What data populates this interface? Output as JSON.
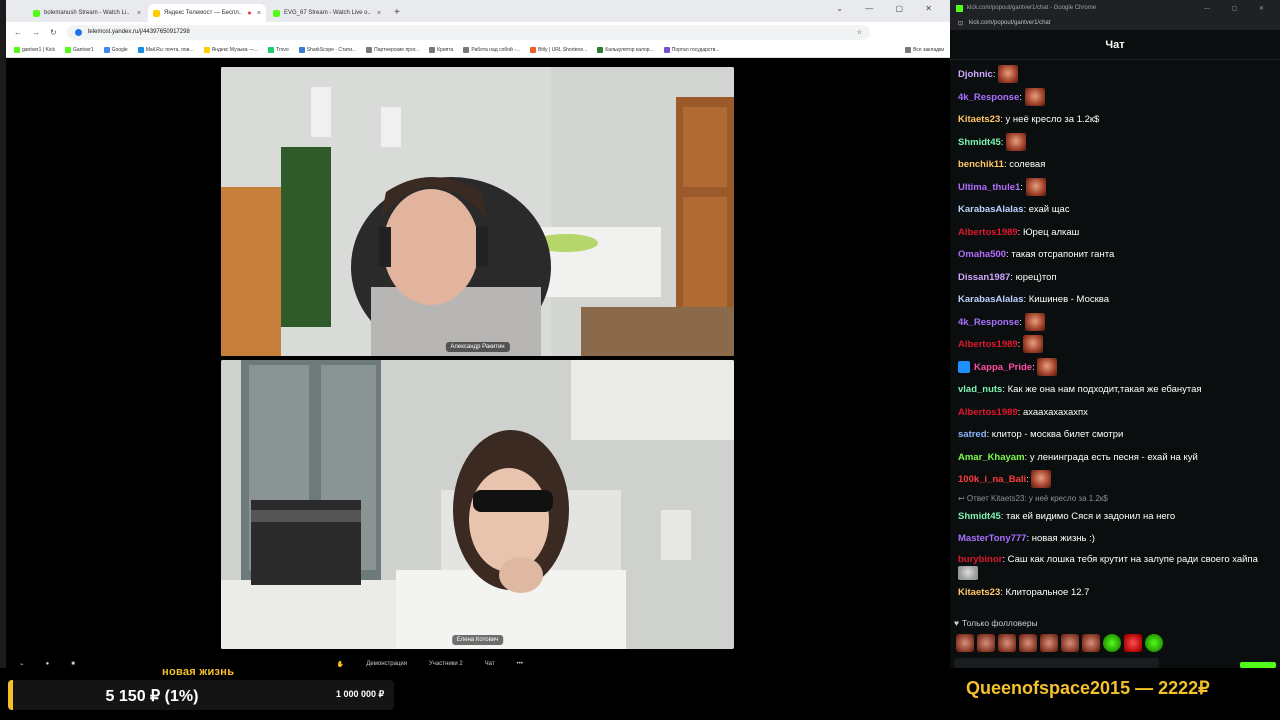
{
  "browser_left": {
    "tabs": [
      {
        "label": "bolemanush Stream - Watch Li..",
        "color": "#53fc18"
      },
      {
        "label": "Яндекс Телемост — Беспл..",
        "color": "#ffcc00"
      },
      {
        "label": "EVG_67 Stream - Watch Live o..",
        "color": "#53fc18"
      }
    ],
    "url": "telemost.yandex.ru/j/44397650917298",
    "bookmarks": [
      "gantver1 | Kick",
      "Gantver1",
      "Google",
      "Mail.Ru: почта, пои...",
      "Яндекс Музыка —...",
      "Trovo",
      "SharkScope - Стати...",
      "Партнерские прог...",
      "Крипта",
      "Работа над собой -...",
      "Bitly | URL Shortene...",
      "Калькулятор калор...",
      "Портал государств...",
      "Все закладки"
    ]
  },
  "call": {
    "participants": [
      {
        "name": "Александр Ракитин"
      },
      {
        "name": "Елена Котович"
      }
    ],
    "controls": [
      "Демонстрация",
      "Участники 2",
      "Чат"
    ]
  },
  "chat_window": {
    "title": "kick.com/popout/gantver1/chat - Google Chrome",
    "url": "kick.com/popout/gantver1/chat",
    "header": "Чат",
    "messages": [
      {
        "user": "Djohnic",
        "color": "#d0a8ff",
        "text": "",
        "emote": true
      },
      {
        "user": "4k_Response",
        "color": "#a970ff",
        "text": "",
        "emote": true
      },
      {
        "user": "Kitaets23",
        "color": "#ffc766",
        "text": "у неё кресло за 1.2к$"
      },
      {
        "user": "Shmidt45",
        "color": "#7cf5b0",
        "text": "",
        "emote": true
      },
      {
        "user": "benchik11",
        "color": "#ffc766",
        "text": "солевая"
      },
      {
        "user": "Ultima_thule1",
        "color": "#b36bff",
        "text": "",
        "emote": true
      },
      {
        "user": "KarabasAlalas",
        "color": "#b9d2ff",
        "text": "ехай щас"
      },
      {
        "user": "Albertos1989",
        "color": "#e0162b",
        "text": "Юрец алкаш"
      },
      {
        "user": "Omaha500",
        "color": "#b36bff",
        "text": "такая отсрапонит ганта"
      },
      {
        "user": "Dissan1987",
        "color": "#d0a8ff",
        "text": "юрец)топ"
      },
      {
        "user": "KarabasAlalas",
        "color": "#b9d2ff",
        "text": "Кишинев - Москва"
      },
      {
        "user": "4k_Response",
        "color": "#a970ff",
        "text": "",
        "emote": true
      },
      {
        "user": "Albertos1989",
        "color": "#e0162b",
        "text": "",
        "emote": true
      },
      {
        "user": "Kappa_Pride",
        "color": "#ff4da6",
        "text": "",
        "emote": true,
        "badge": true
      },
      {
        "user": "vlad_nuts",
        "color": "#7cf5b0",
        "text": "Как же она нам подходит,такая же ебанутая"
      },
      {
        "user": "Albertos1989",
        "color": "#e0162b",
        "text": "ахаахахахахпх"
      },
      {
        "user": "satred",
        "color": "#8cb8ff",
        "text": "клитор - москва билет смотри"
      },
      {
        "user": "Amar_Khayam",
        "color": "#7cfc4a",
        "text": "у ленинграда есть песня - ехай на куй"
      },
      {
        "user": "100k_i_na_Bali",
        "color": "#ff3b3b",
        "text": "",
        "emote": true
      }
    ],
    "reply_note": "Ответ Kitaets23: у неё кресло за 1.2к$",
    "messages_after": [
      {
        "user": "Shmidt45",
        "color": "#7cf5b0",
        "text": "так ей видимо Сяся и задонил на него"
      },
      {
        "user": "MasterTony777",
        "color": "#a970ff",
        "text": "новая жизнь :)"
      },
      {
        "user": "burybinor",
        "color": "#e0162b",
        "text": "Саш как лошка тебя крутит на залупе ради своего хайпа",
        "emote_cat": true
      },
      {
        "user": "Kitaets23",
        "color": "#ffc766",
        "text": "Клиторальное 12.7"
      }
    ],
    "followers_only": "Только фолловеры"
  },
  "goal": {
    "title": "новая жизнь",
    "current": "5 150 ₽ (1%)",
    "target": "1 000 000 ₽",
    "progress_fraction": 0.01
  },
  "donation": {
    "text": "Queenofspace2015 — 2222₽"
  }
}
